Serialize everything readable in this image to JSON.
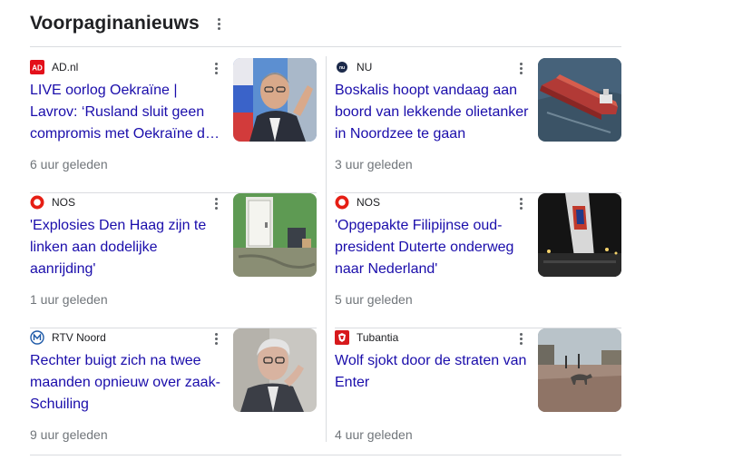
{
  "section": {
    "title": "Voorpaginanieuws"
  },
  "articles": [
    {
      "source": "AD.nl",
      "title": "LIVE oorlog Oekraïne | Lavrov: ‘Rusland sluit geen compromis met Oekraïne d…",
      "time": "6 uur geleden",
      "logo": "ad-logo",
      "thumb": "lavrov-photo"
    },
    {
      "source": "NU",
      "title": "Boskalis hoopt vandaag aan boord van lekkende olietanker in Noordzee te gaan",
      "time": "3 uur geleden",
      "logo": "nu-logo",
      "thumb": "tanker-photo"
    },
    {
      "source": "NOS",
      "title": "'Explosies Den Haag zijn te linken aan dodelijke aanrijding'",
      "time": "1 uur geleden",
      "logo": "nos-logo",
      "thumb": "door-photo"
    },
    {
      "source": "NOS",
      "title": "'Opgepakte Filipijnse oud-president Duterte onderweg naar Nederland'",
      "time": "5 uur geleden",
      "logo": "nos-logo",
      "thumb": "airplane-photo"
    },
    {
      "source": "RTV Noord",
      "title": "Rechter buigt zich na twee maanden opnieuw over zaak-Schuiling",
      "time": "9 uur geleden",
      "logo": "rtv-noord-logo",
      "thumb": "man-photo"
    },
    {
      "source": "Tubantia",
      "title": "Wolf sjokt door de straten van Enter",
      "time": "4 uur geleden",
      "logo": "tubantia-logo",
      "thumb": "wolf-street-photo"
    }
  ],
  "colors": {
    "link": "#1a0dab",
    "meta": "#70757a",
    "divider": "#dadce0",
    "ad_red": "#e3101a",
    "nos_red": "#e61e14"
  }
}
